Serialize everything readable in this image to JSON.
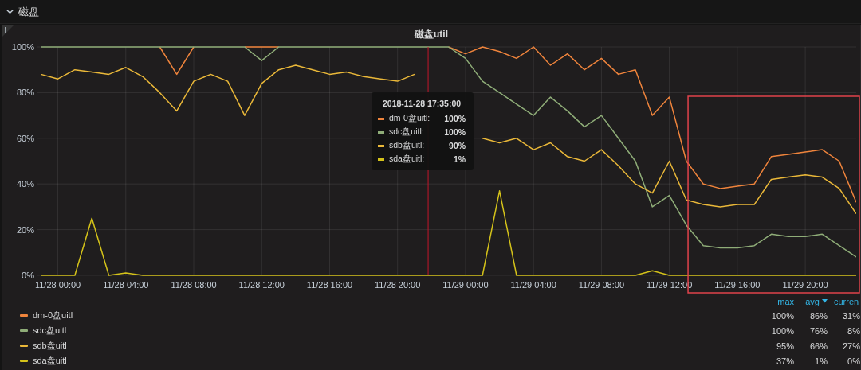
{
  "row": {
    "title": "磁盘",
    "expanded": true
  },
  "panel": {
    "chart_data": {
      "type": "line",
      "title": "磁盘util",
      "grid": true,
      "categories": [
        null,
        "11/28 00:00",
        null,
        null,
        null,
        "11/28 04:00",
        null,
        null,
        null,
        "11/28 08:00",
        null,
        null,
        null,
        "11/28 12:00",
        null,
        null,
        null,
        "11/28 16:00",
        null,
        null,
        null,
        "11/28 20:00",
        null,
        null,
        null,
        "11/29 00:00",
        null,
        null,
        null,
        "11/29 04:00",
        null,
        null,
        null,
        "11/29 08:00",
        null,
        null,
        null,
        "11/29 12:00",
        null,
        null,
        null,
        "11/29 16:00",
        null,
        null,
        null,
        "11/29 20:00",
        null,
        null,
        null
      ],
      "series": [
        {
          "name": "dm-0盘uitl",
          "color": "#ef843c",
          "values": [
            null,
            null,
            null,
            null,
            null,
            null,
            null,
            100,
            88,
            100,
            null,
            null,
            100,
            100,
            100,
            null,
            null,
            null,
            null,
            null,
            null,
            null,
            null,
            null,
            100,
            97,
            100,
            98,
            95,
            100,
            92,
            97,
            90,
            95,
            88,
            90,
            70,
            78,
            50,
            40,
            38,
            39,
            40,
            52,
            53,
            54,
            55,
            50,
            32
          ]
        },
        {
          "name": "sdc盘uitl",
          "color": "#8fad78",
          "values": [
            100,
            100,
            100,
            100,
            100,
            100,
            100,
            100,
            100,
            100,
            100,
            100,
            100,
            94,
            100,
            100,
            100,
            100,
            100,
            100,
            100,
            100,
            100,
            100,
            100,
            95,
            85,
            80,
            75,
            70,
            78,
            72,
            65,
            70,
            60,
            50,
            30,
            35,
            22,
            13,
            12,
            12,
            13,
            18,
            17,
            17,
            18,
            13,
            8
          ]
        },
        {
          "name": "sdb盘uitl",
          "color": "#eab839",
          "values": [
            88,
            86,
            90,
            89,
            88,
            91,
            87,
            80,
            72,
            85,
            88,
            85,
            70,
            84,
            90,
            92,
            90,
            88,
            89,
            87,
            86,
            85,
            88,
            null,
            null,
            null,
            60,
            58,
            60,
            55,
            58,
            52,
            50,
            55,
            48,
            40,
            36,
            50,
            33,
            31,
            30,
            31,
            31,
            42,
            43,
            44,
            43,
            38,
            27
          ]
        },
        {
          "name": "sda盘uitl",
          "color": "#d4c21a",
          "values": [
            0,
            0,
            0,
            25,
            0,
            1,
            0,
            0,
            0,
            0,
            0,
            0,
            0,
            0,
            0,
            0,
            0,
            0,
            0,
            0,
            0,
            0,
            0,
            0,
            0,
            0,
            0,
            37,
            0,
            0,
            0,
            0,
            0,
            0,
            0,
            0,
            2,
            0,
            0,
            0,
            0,
            0,
            0,
            0,
            0,
            0,
            0,
            0,
            0
          ]
        }
      ],
      "ylim": [
        0,
        100
      ],
      "yticks": [
        {
          "value": 0,
          "label": "0%"
        },
        {
          "value": 20,
          "label": "20%"
        },
        {
          "value": 40,
          "label": "40%"
        },
        {
          "value": 60,
          "label": "60%"
        },
        {
          "value": 80,
          "label": "80%"
        },
        {
          "value": 100,
          "label": "100%"
        }
      ]
    },
    "tooltip": {
      "time": "2018-11-28 17:35:00",
      "rows": [
        {
          "label": "dm-0盘uitl:",
          "value": "100%",
          "color": "#ef843c"
        },
        {
          "label": "sdc盘uitl:",
          "value": "100%",
          "color": "#8fad78"
        },
        {
          "label": "sdb盘uitl:",
          "value": "90%",
          "color": "#eab839"
        },
        {
          "label": "sda盘uitl:",
          "value": "1%",
          "color": "#d4c21a"
        }
      ]
    },
    "legend": {
      "columns": [
        {
          "label": "max",
          "sorted": false
        },
        {
          "label": "avg",
          "sorted": true
        },
        {
          "label": "curren",
          "sorted": false
        }
      ],
      "rows": [
        {
          "values": [
            "100%",
            "86%",
            "31%"
          ]
        },
        {
          "values": [
            "100%",
            "76%",
            "8%"
          ]
        },
        {
          "values": [
            "95%",
            "66%",
            "27%"
          ]
        },
        {
          "values": [
            "37%",
            "1%",
            "0%"
          ]
        }
      ]
    }
  }
}
